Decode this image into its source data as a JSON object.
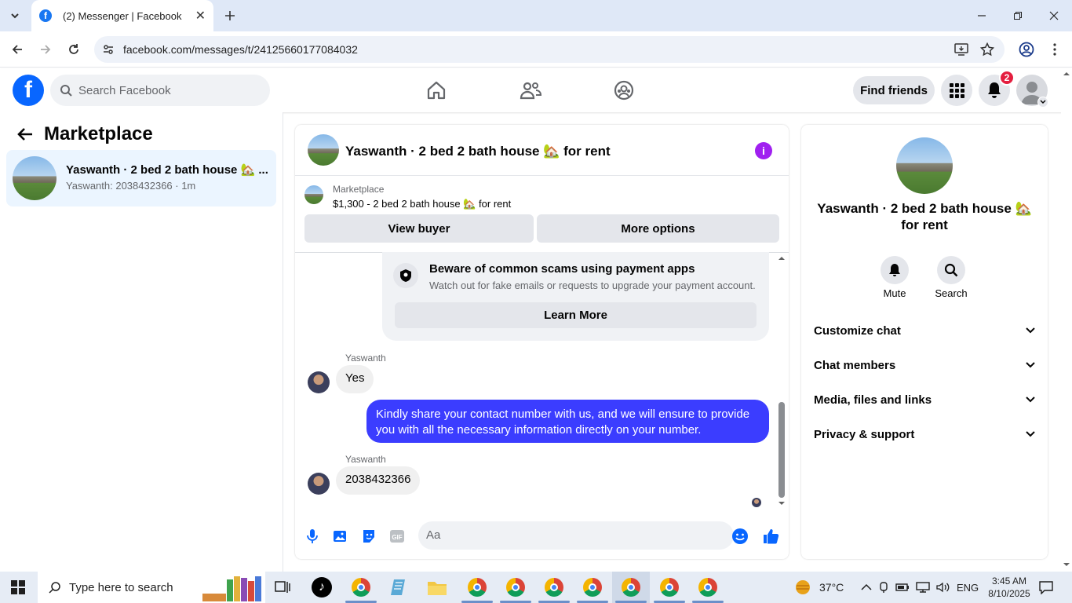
{
  "browser": {
    "tab_title": "(2) Messenger | Facebook",
    "url": "facebook.com/messages/t/24125660177084032"
  },
  "fb": {
    "search_placeholder": "Search Facebook",
    "find_friends": "Find friends",
    "notification_count": "2"
  },
  "sidebar": {
    "title": "Marketplace",
    "conversation": {
      "name": "Yaswanth · 2 bed 2 bath house 🏡 ...",
      "preview": "Yaswanth: 2038432366 · 1m"
    }
  },
  "chat": {
    "title": "Yaswanth · 2 bed 2 bath house 🏡 for rent",
    "marketplace_label": "Marketplace",
    "listing": "$1,300 - 2 bed 2 bath house 🏡 for rent",
    "view_buyer": "View buyer",
    "more_options": "More options",
    "notice_title": "Beware of common scams using payment apps",
    "notice_desc": "Watch out for fake emails or requests to upgrade your payment account.",
    "learn_more": "Learn More",
    "messages": [
      {
        "sender": "Yaswanth",
        "text": "Yes"
      },
      {
        "sender": "me",
        "text": "Kindly share your contact number with us, and we will ensure to provide you with all the necessary information directly on your number."
      },
      {
        "sender": "Yaswanth",
        "text": "2038432366"
      }
    ],
    "input_placeholder": "Aa"
  },
  "details": {
    "name": "Yaswanth · 2 bed 2 bath house 🏡 for rent",
    "mute": "Mute",
    "search": "Search",
    "sections": [
      "Customize chat",
      "Chat members",
      "Media, files and links",
      "Privacy & support"
    ]
  },
  "taskbar": {
    "search": "Type here to search",
    "temp": "37°C",
    "lang": "ENG",
    "time": "3:45 AM",
    "date": "8/10/2025"
  }
}
